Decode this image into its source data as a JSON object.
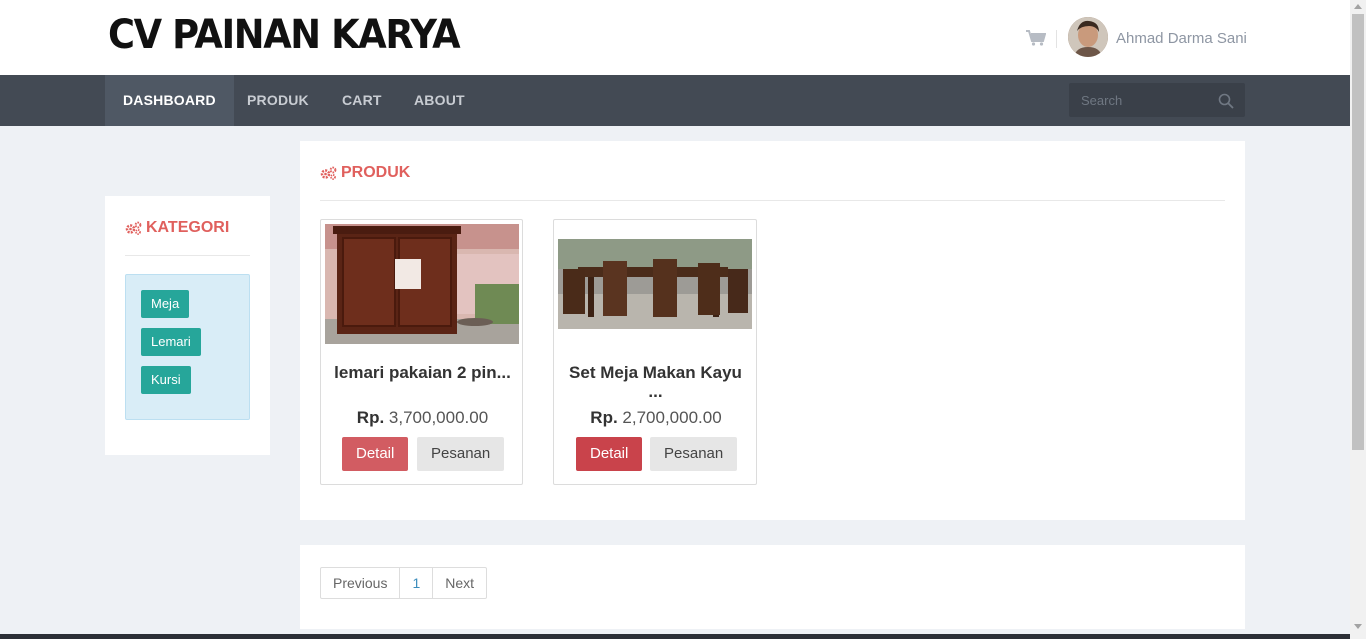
{
  "brand": {
    "title": "CV PAINAN KARYA"
  },
  "user": {
    "name": "Ahmad Darma Sani"
  },
  "nav": {
    "items": [
      "DASHBOARD",
      "PRODUK",
      "CART",
      "ABOUT"
    ],
    "active": "DASHBOARD"
  },
  "search": {
    "placeholder": "Search"
  },
  "sidebar": {
    "title": "KATEGORI",
    "categories": [
      "Meja",
      "Lemari",
      "Kursi"
    ]
  },
  "products": {
    "title": "PRODUK",
    "items": [
      {
        "name": "lemari pakaian 2 pin...",
        "currency": "Rp.",
        "price": "3,700,000.00",
        "detail_label": "Detail",
        "order_label": "Pesanan"
      },
      {
        "name": "Set Meja Makan Kayu ...",
        "currency": "Rp.",
        "price": "2,700,000.00",
        "detail_label": "Detail",
        "order_label": "Pesanan"
      }
    ]
  },
  "pagination": {
    "previous": "Previous",
    "page": "1",
    "next": "Next"
  },
  "colors": {
    "accent": "#e0605d",
    "nav_bg": "#434a54",
    "category_btn": "#26a69a",
    "detail_btn": "#c9434b",
    "page_bg": "#eef1f5"
  },
  "icons": {
    "cart": "cart-icon",
    "search": "search-icon",
    "title": "gears-icon"
  }
}
